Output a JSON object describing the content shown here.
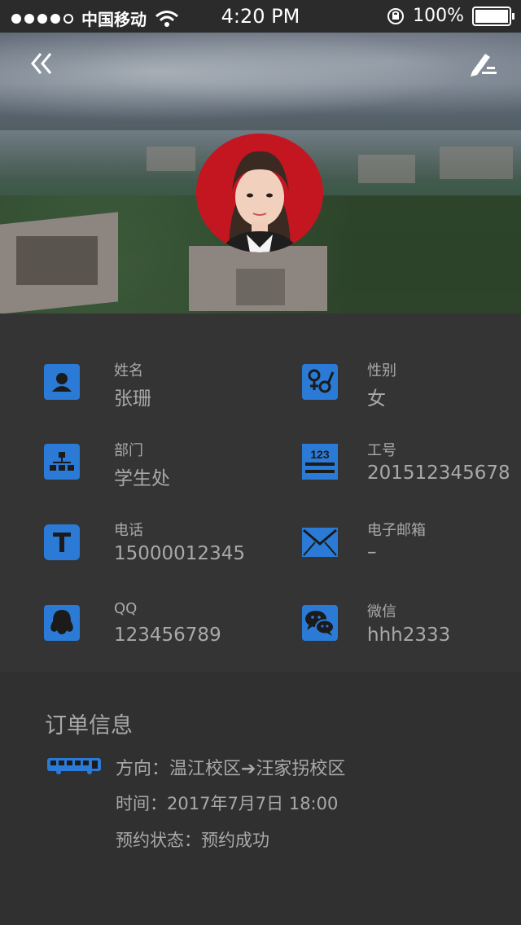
{
  "status_bar": {
    "carrier": "中国移动",
    "time": "4:20 PM",
    "battery": "100%"
  },
  "header": {
    "back_icon": "double-chevron-left-icon",
    "edit_icon": "pen-edit-icon"
  },
  "profile": {
    "fields": [
      {
        "label": "姓名",
        "value": "张珊",
        "icon": "person-icon"
      },
      {
        "label": "性别",
        "value": "女",
        "icon": "gender-icon"
      },
      {
        "label": "部门",
        "value": "学生处",
        "icon": "org-chart-icon"
      },
      {
        "label": "工号",
        "value": "201512345678",
        "icon": "id-number-icon"
      },
      {
        "label": "电话",
        "value": "15000012345",
        "icon": "phone-t-icon"
      },
      {
        "label": "电子邮箱",
        "value": "–",
        "icon": "mail-icon"
      },
      {
        "label": "QQ",
        "value": "123456789",
        "icon": "qq-icon"
      },
      {
        "label": "微信",
        "value": "hhh2333",
        "icon": "wechat-icon"
      }
    ]
  },
  "order": {
    "title": "订单信息",
    "bus_icon": "bus-icon",
    "direction": "方向：温江校区➔汪家拐校区",
    "time": "时间：2017年7月7日 18:00",
    "status": "预约状态：预约成功"
  },
  "colors": {
    "accent": "#2b7bd6",
    "text": "#a9a9a9",
    "panel": "#343434"
  }
}
